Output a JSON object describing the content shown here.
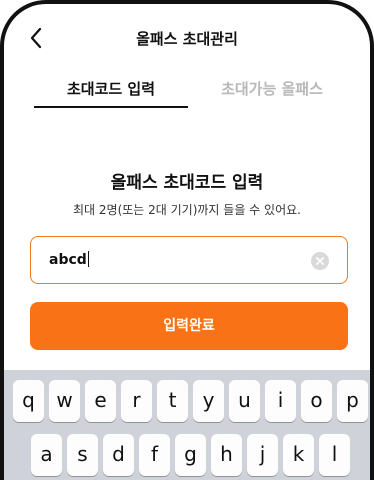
{
  "header": {
    "title": "올패스 초대관리"
  },
  "tabs": [
    {
      "label": "초대코드 입력",
      "active": true
    },
    {
      "label": "초대가능 올패스",
      "active": false
    }
  ],
  "section": {
    "title": "올패스 초대코드 입력",
    "subtitle": "최대 2명(또는 2대 기기)까지 들을 수 있어요."
  },
  "input": {
    "value": "abcd",
    "border_color": "#f07a1f"
  },
  "submit": {
    "label": "입력완료",
    "color": "#f97316"
  },
  "keyboard": {
    "row1": [
      "q",
      "w",
      "e",
      "r",
      "t",
      "y",
      "u",
      "i",
      "o",
      "p"
    ],
    "row2": [
      "a",
      "s",
      "d",
      "f",
      "g",
      "h",
      "j",
      "k",
      "l"
    ]
  },
  "icons": {
    "back": "chevron-left-icon",
    "clear": "clear-circle-icon"
  }
}
